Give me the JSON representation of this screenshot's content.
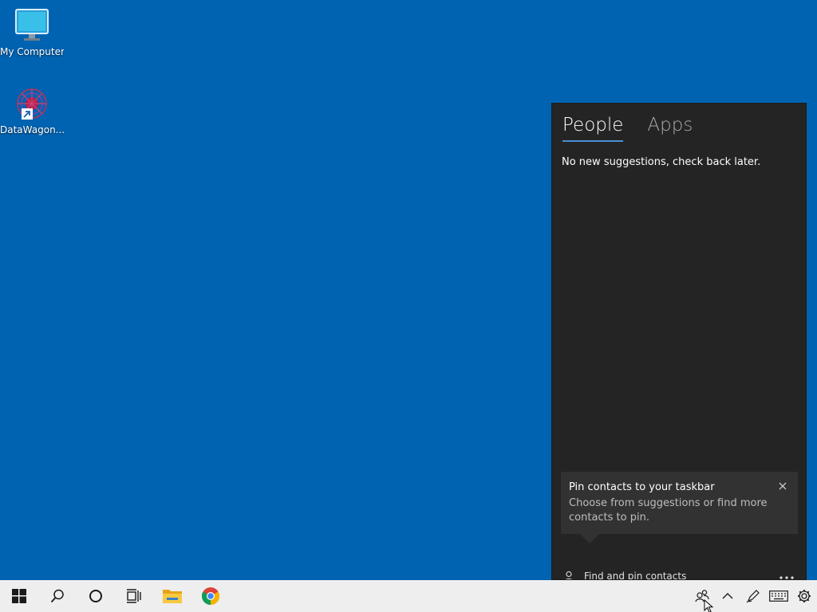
{
  "desktop": {
    "icons": [
      {
        "label": "My Computer",
        "icon": "monitor-icon"
      },
      {
        "label": "DataWagon...",
        "icon": "datawagon-app-icon"
      }
    ]
  },
  "people_panel": {
    "tabs": [
      {
        "label": "People",
        "active": true
      },
      {
        "label": "Apps",
        "active": false
      }
    ],
    "empty_message": "No new suggestions, check back later.",
    "tip": {
      "title": "Pin contacts to your taskbar",
      "body": "Choose from suggestions or find more contacts to pin."
    },
    "find_label": "Find and pin contacts"
  },
  "taskbar": {
    "buttons": [
      "windows-start-icon",
      "search-icon",
      "cortana-icon",
      "task-view-icon",
      "file-explorer-icon",
      "chrome-icon"
    ],
    "tray": [
      "people-icon",
      "chevron-up-icon",
      "pen-icon",
      "keyboard-icon",
      "settings-icon"
    ]
  },
  "colors": {
    "desktop_bg": "#0063b1",
    "panel_bg": "#242424",
    "tab_accent": "#4a8fd6",
    "taskbar_bg": "#eeeeee"
  }
}
